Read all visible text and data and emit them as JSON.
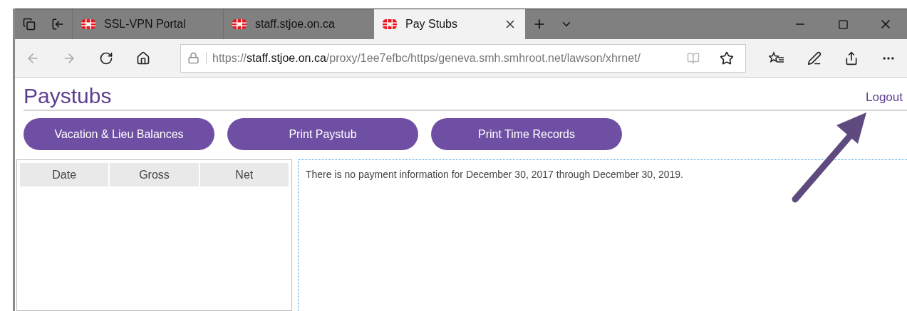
{
  "browser": {
    "tabs": [
      {
        "label": "SSL-VPN Portal",
        "selected": false
      },
      {
        "label": "staff.stjoe.on.ca",
        "selected": false
      },
      {
        "label": "Pay Stubs",
        "selected": true
      }
    ],
    "address": {
      "scheme": "https://",
      "host": "staff.stjoe.on.ca",
      "path": "/proxy/1ee7efbc/https/geneva.smh.smhroot.net/lawson/xhrnet/"
    }
  },
  "page": {
    "title": "Paystubs",
    "logout": "Logout",
    "buttons": [
      "Vacation & Lieu Balances",
      "Print Paystub",
      "Print Time Records"
    ],
    "table": {
      "columns": [
        "Date",
        "Gross",
        "Net"
      ]
    },
    "message": "There is no payment information for December 30, 2017 through December 30, 2019."
  }
}
